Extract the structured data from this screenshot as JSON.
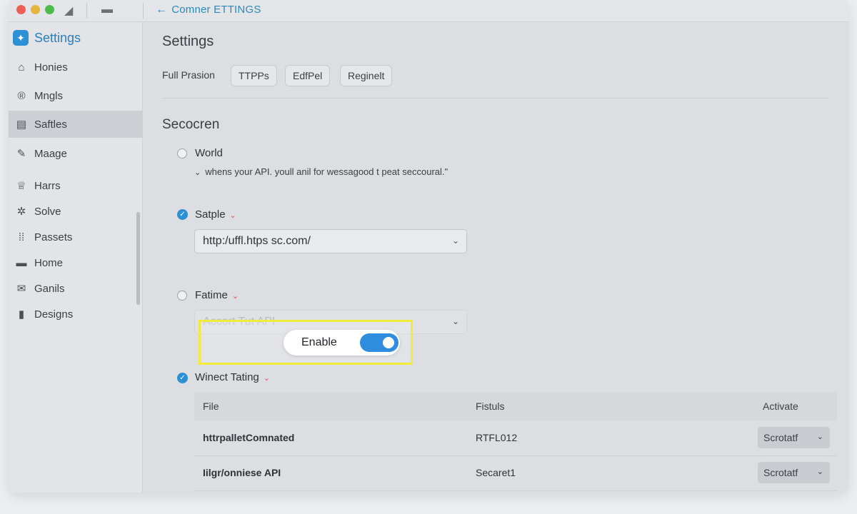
{
  "window": {
    "back_label": "Comner ETTINGS"
  },
  "sidebar": {
    "title": "Settings",
    "items": [
      {
        "label": "Honies",
        "icon": "house-icon",
        "glyph": "⌂"
      },
      {
        "label": "Mngls",
        "icon": "registered-icon",
        "glyph": "®"
      },
      {
        "label": "Saftles",
        "icon": "card-icon",
        "glyph": "▤"
      },
      {
        "label": "Maage",
        "icon": "wrench-icon",
        "glyph": "✎"
      },
      {
        "label": "Harrs",
        "icon": "basket-icon",
        "glyph": "♕"
      },
      {
        "label": "Solve",
        "icon": "gears-icon",
        "glyph": "✲"
      },
      {
        "label": "Passets",
        "icon": "grid-icon",
        "glyph": "⁞⁞"
      },
      {
        "label": "Home",
        "icon": "tray-icon",
        "glyph": "▬"
      },
      {
        "label": "Ganils",
        "icon": "mail-icon",
        "glyph": "✉"
      },
      {
        "label": "Designs",
        "icon": "document-icon",
        "glyph": "▮"
      }
    ]
  },
  "main": {
    "title": "Settings",
    "permission_label": "Full Prasion",
    "chips": [
      "TTPPs",
      "EdfPel",
      "Reginelt"
    ],
    "section_title": "Secocren",
    "options": {
      "world": {
        "label": "World",
        "description": "whens your API. youll anil for wessagood t peat seccoural.\""
      },
      "satple": {
        "label": "Satple",
        "value": "http:/uffl.htps sc.com/"
      },
      "fatime": {
        "label": "Fatime",
        "value": "Accort Tut API"
      },
      "winect": {
        "label": "Winect Tating"
      }
    },
    "enable": {
      "label": "Enable",
      "state": "on"
    },
    "table": {
      "headers": [
        "File",
        "Fistuls",
        "Activate"
      ],
      "rows": [
        {
          "file": "httrpalletComnated",
          "status": "RTFL012",
          "action": "Scrotatf"
        },
        {
          "file": "Iilgr/onniese API",
          "status": "Secaret1",
          "action": "Scrotatf"
        }
      ]
    }
  }
}
